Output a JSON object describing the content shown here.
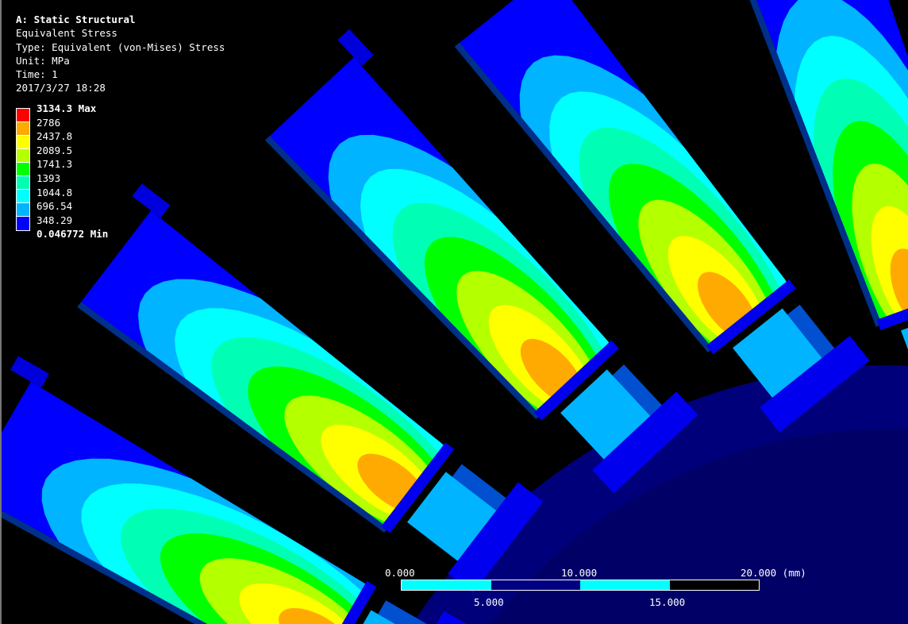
{
  "header": {
    "title": "A: Static Structural",
    "result": "Equivalent Stress",
    "type": "Type: Equivalent (von-Mises) Stress",
    "unit": "Unit: MPa",
    "time": "Time: 1",
    "date": "2017/3/27 18:28"
  },
  "legend": {
    "levels": [
      {
        "label": "3134.3 Max",
        "color": "#ff0000"
      },
      {
        "label": "2786",
        "color": "#ffaa00"
      },
      {
        "label": "2437.8",
        "color": "#ffff00"
      },
      {
        "label": "2089.5",
        "color": "#b4ff00"
      },
      {
        "label": "1741.3",
        "color": "#00ff00"
      },
      {
        "label": "1393",
        "color": "#00ffb4"
      },
      {
        "label": "1044.8",
        "color": "#00ffff"
      },
      {
        "label": "696.54",
        "color": "#00b4ff"
      },
      {
        "label": "348.29",
        "color": "#0000ff"
      },
      {
        "label": "0.046772 Min"
      }
    ]
  },
  "scale_bar": {
    "top_labels": [
      "0.000",
      "10.000",
      "20.000 (mm)"
    ],
    "bottom_labels": [
      "5.000",
      "15.000"
    ],
    "colors": [
      "#00ffff",
      "#000080",
      "#00ffff",
      "#000000"
    ]
  }
}
